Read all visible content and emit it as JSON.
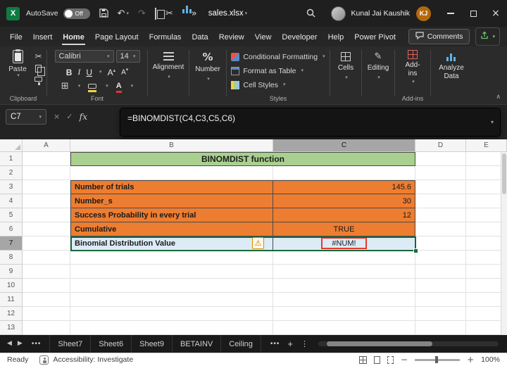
{
  "titlebar": {
    "autosave_label": "AutoSave",
    "autosave_state": "Off",
    "filename": "sales.xlsx",
    "user_name": "Kunal Jai Kaushik",
    "user_initials": "KJ"
  },
  "menubar": {
    "items": [
      "File",
      "Insert",
      "Home",
      "Page Layout",
      "Formulas",
      "Data",
      "Review",
      "View",
      "Developer",
      "Help",
      "Power Pivot"
    ],
    "active_item": "Home",
    "comments_label": "Comments"
  },
  "ribbon": {
    "paste_label": "Paste",
    "clipboard_group_label": "Clipboard",
    "font_name": "Calibri",
    "font_size": "14",
    "bold_label": "B",
    "italic_label": "I",
    "underline_label": "U",
    "grow_font_label": "A",
    "shrink_font_label": "A",
    "font_color_label": "A",
    "font_group_label": "Font",
    "alignment_label": "Alignment",
    "number_label": "Number",
    "conditional_formatting_label": "Conditional Formatting",
    "format_as_table_label": "Format as Table",
    "cell_styles_label": "Cell Styles",
    "styles_group_label": "Styles",
    "cells_label": "Cells",
    "editing_label": "Editing",
    "addins_label": "Add-ins",
    "addins_group_label": "Add-ins",
    "analyze_data_label": "Analyze Data"
  },
  "formula_bar": {
    "name_box": "C7",
    "fx_label": "fx",
    "formula": "=BINOMDIST(C4,C3,C5,C6)"
  },
  "grid": {
    "columns": [
      "A",
      "B",
      "C",
      "D",
      "E"
    ],
    "rows": [
      "1",
      "2",
      "3",
      "4",
      "5",
      "6",
      "7",
      "8",
      "9",
      "10",
      "11",
      "12",
      "13"
    ],
    "title": "BINOMDIST function",
    "cells": {
      "b3": "Number of trials",
      "c3": "145.6",
      "b4": "Number_s",
      "c4": "30",
      "b5": "Success Probability in every trial",
      "c5": "12",
      "b6": "Cumulative",
      "c6": "TRUE",
      "b7": "Binomial Distribution Value",
      "c7": "#NUM!"
    },
    "selected_cell": "C7"
  },
  "sheet_tabs": {
    "tabs": [
      "Sheet7",
      "Sheet6",
      "Sheet9",
      "BETAINV",
      "Ceiling"
    ],
    "add_label": "+"
  },
  "status_bar": {
    "ready": "Ready",
    "accessibility": "Accessibility: Investigate",
    "zoom": "100%"
  },
  "colors": {
    "header_fill": "#ED7D31",
    "title_fill": "#A9D08E",
    "result_fill": "#DDEBF7",
    "selection_border": "#17693B",
    "error_outline": "#E8392B",
    "accent_green": "#107C41"
  }
}
